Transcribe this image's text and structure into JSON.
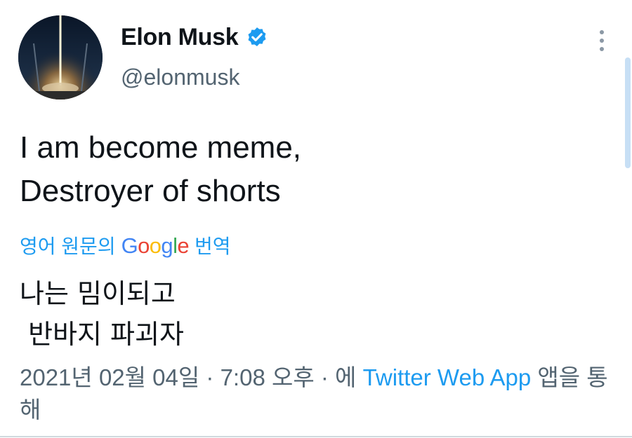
{
  "user": {
    "display_name": "Elon Musk",
    "handle": "@elonmusk",
    "verified": true
  },
  "icons": {
    "verified": "verified-badge-icon",
    "more": "more-vertical-icon"
  },
  "tweet": {
    "text": "I am become meme,\nDestroyer of shorts"
  },
  "translation": {
    "prefix": "영어 원문의",
    "google": "Google",
    "suffix": "번역",
    "text": "나는 밈이되고\n 반바지 파괴자"
  },
  "meta": {
    "date": "2021년 02월 04일",
    "sep1": " · ",
    "time": "7:08 오후",
    "sep2": " · 에 ",
    "source": "Twitter Web App",
    "tail": " 앱을 통해"
  },
  "colors": {
    "accent": "#1d9bf0",
    "text": "#0f1419",
    "secondary": "#536471"
  }
}
